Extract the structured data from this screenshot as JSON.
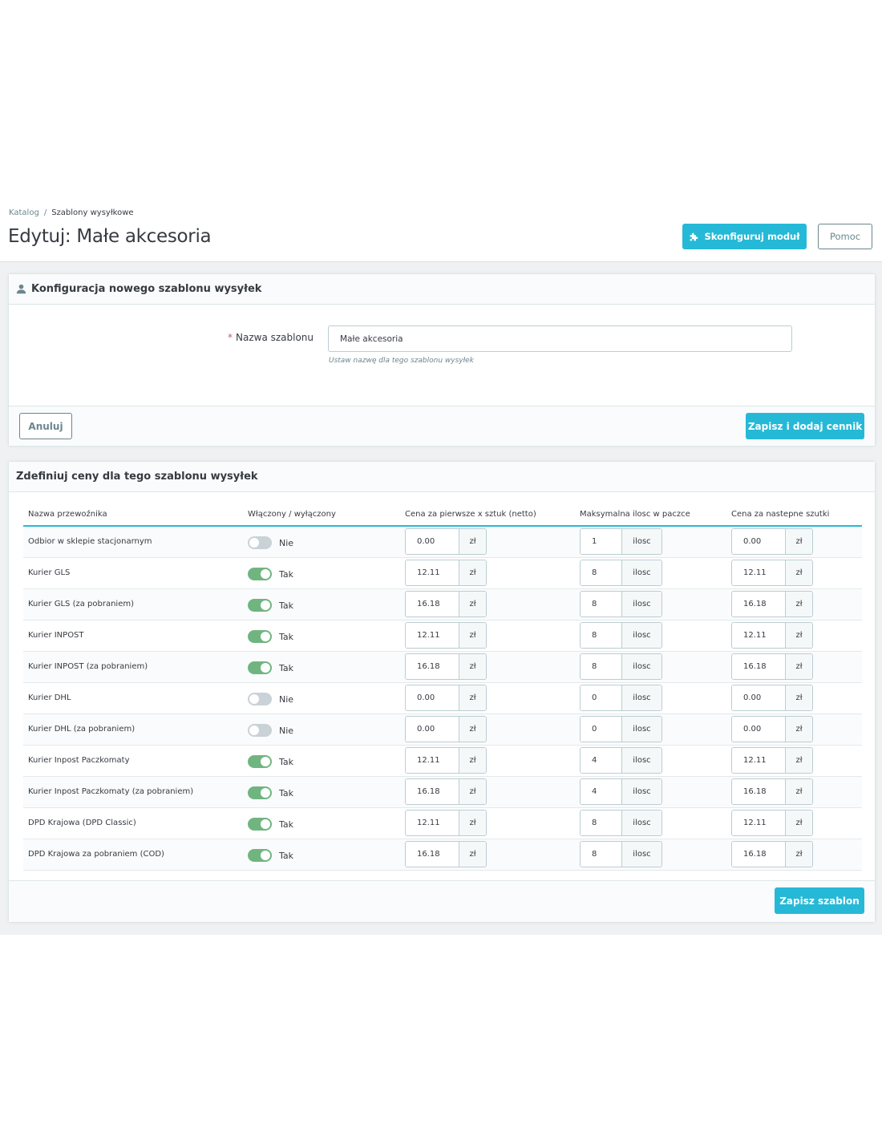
{
  "breadcrumb": {
    "parent": "Katalog",
    "separator": "/",
    "current": "Szablony wysyłkowe"
  },
  "page_title": "Edytuj: Małe akcesoria",
  "toolbar": {
    "configure_label": "Skonfiguruj moduł",
    "help_label": "Pomoc"
  },
  "colors": {
    "accent": "#25b9d7",
    "toggle_on": "#70b580",
    "toggle_off": "#c9d2d6"
  },
  "config_panel": {
    "title": "Konfiguracja nowego szablonu wysyłek",
    "icon": "user-icon",
    "name_label": "Nazwa szablonu",
    "required_mark": "*",
    "name_value": "Małe akcesoria",
    "help_text": "Ustaw nazwę dla tego szablonu wysyłek",
    "cancel_label": "Anuluj",
    "save_add_label": "Zapisz i dodaj cennik"
  },
  "prices_panel": {
    "title": "Zdefiniuj ceny dla tego szablonu wysyłek",
    "columns": [
      "Nazwa przewoźnika",
      "Włączony / wyłączony",
      "Cena za pierwsze x sztuk (netto)",
      "Maksymalna ilosc w paczce",
      "Cena za nastepne szutki"
    ],
    "currency_unit": "zł",
    "qty_unit": "ilosc",
    "rows": [
      {
        "carrier": "Odbior w sklepie stacjonarnym",
        "enabled": false,
        "status": "Nie",
        "first_price": "0.00",
        "max_qty": "1",
        "next_price": "0.00"
      },
      {
        "carrier": "Kurier GLS",
        "enabled": true,
        "status": "Tak",
        "first_price": "12.11",
        "max_qty": "8",
        "next_price": "12.11"
      },
      {
        "carrier": "Kurier GLS (za pobraniem)",
        "enabled": true,
        "status": "Tak",
        "first_price": "16.18",
        "max_qty": "8",
        "next_price": "16.18"
      },
      {
        "carrier": "Kurier INPOST",
        "enabled": true,
        "status": "Tak",
        "first_price": "12.11",
        "max_qty": "8",
        "next_price": "12.11"
      },
      {
        "carrier": "Kurier INPOST (za pobraniem)",
        "enabled": true,
        "status": "Tak",
        "first_price": "16.18",
        "max_qty": "8",
        "next_price": "16.18"
      },
      {
        "carrier": "Kurier DHL",
        "enabled": false,
        "status": "Nie",
        "first_price": "0.00",
        "max_qty": "0",
        "next_price": "0.00"
      },
      {
        "carrier": "Kurier DHL (za pobraniem)",
        "enabled": false,
        "status": "Nie",
        "first_price": "0.00",
        "max_qty": "0",
        "next_price": "0.00"
      },
      {
        "carrier": "Kurier Inpost Paczkomaty",
        "enabled": true,
        "status": "Tak",
        "first_price": "12.11",
        "max_qty": "4",
        "next_price": "12.11"
      },
      {
        "carrier": "Kurier Inpost Paczkomaty (za pobraniem)",
        "enabled": true,
        "status": "Tak",
        "first_price": "16.18",
        "max_qty": "4",
        "next_price": "16.18"
      },
      {
        "carrier": "DPD Krajowa (DPD Classic)",
        "enabled": true,
        "status": "Tak",
        "first_price": "12.11",
        "max_qty": "8",
        "next_price": "12.11"
      },
      {
        "carrier": "DPD Krajowa za pobraniem (COD)",
        "enabled": true,
        "status": "Tak",
        "first_price": "16.18",
        "max_qty": "8",
        "next_price": "16.18"
      }
    ],
    "save_label": "Zapisz szablon"
  }
}
